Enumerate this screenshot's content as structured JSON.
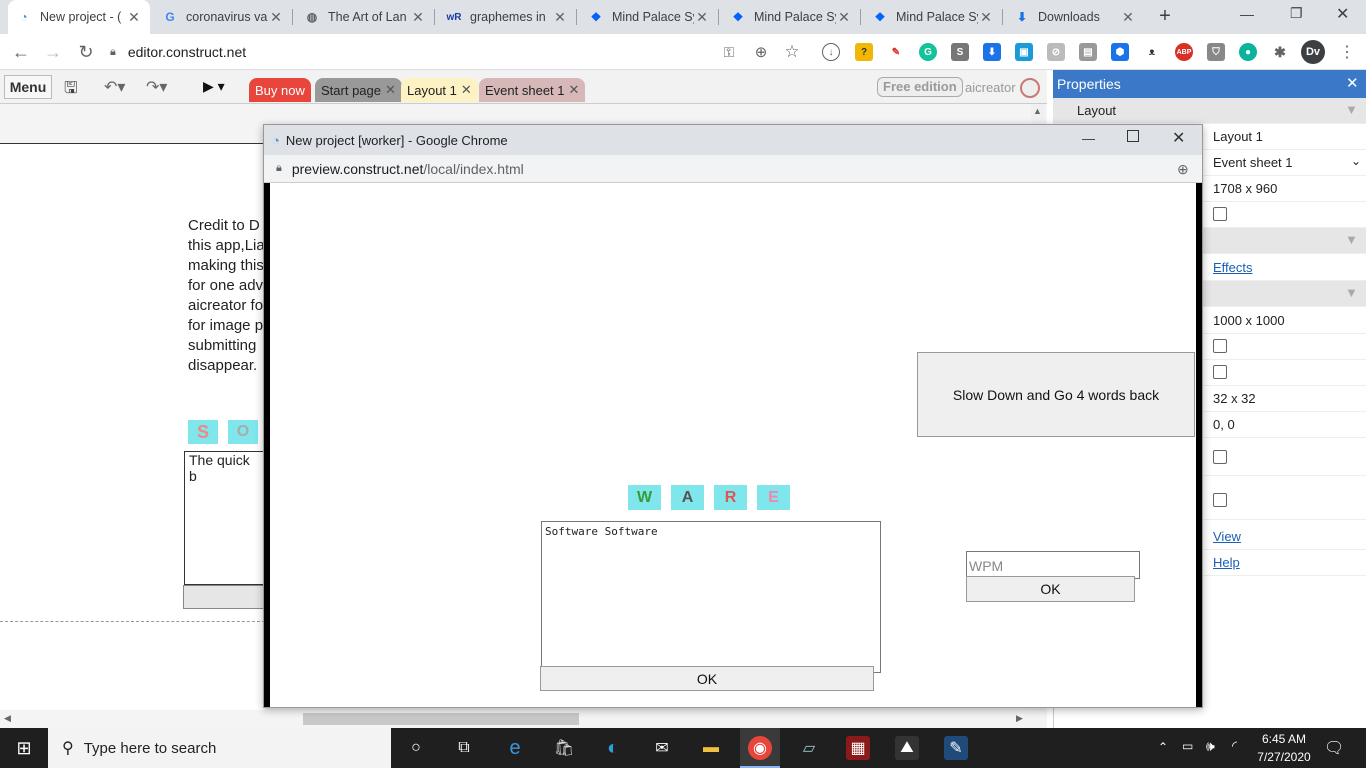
{
  "browser": {
    "tabs": [
      {
        "title": "New project - (",
        "icon": "construct-icon",
        "active": true
      },
      {
        "title": "coronavirus va",
        "icon": "google-icon"
      },
      {
        "title": "The Art of Lan",
        "icon": "globe-icon"
      },
      {
        "title": "graphemes in",
        "icon": "wordreference-icon"
      },
      {
        "title": "Mind Palace Sy",
        "icon": "dropbox-icon"
      },
      {
        "title": "Mind Palace Sy",
        "icon": "dropbox-icon"
      },
      {
        "title": "Mind Palace Sy",
        "icon": "dropbox-icon"
      },
      {
        "title": "Downloads",
        "icon": "download-icon"
      }
    ],
    "url": "editor.construct.net",
    "profile": "Dv"
  },
  "construct": {
    "menu_label": "Menu",
    "tabs": [
      "Buy now",
      "Start page",
      "Layout 1",
      "Event sheet 1"
    ],
    "edition_badge": "Free edition",
    "username": "aicreator",
    "credit_text": "Credit to D this app,Lia making this for one adv aicreator fo for image p submitting disappear.",
    "textbox_text": "The quick b"
  },
  "properties": {
    "title": "Properties",
    "section": "Layout",
    "rows": [
      {
        "value": "Layout 1"
      },
      {
        "value": "Event sheet 1"
      },
      {
        "value": "1708 x 960"
      },
      {
        "value": "Effects"
      },
      {
        "value": "1000 x 1000"
      },
      {
        "value": "32 x 32"
      },
      {
        "value": "0, 0"
      },
      {
        "value": "View"
      },
      {
        "value": "Help"
      }
    ]
  },
  "popup": {
    "title": "New project [worker] - Google Chrome",
    "url_host": "preview.construct.net",
    "url_path": "/local/index.html",
    "slow_button": "Slow Down and Go 4 words back",
    "tiles": [
      "W",
      "A",
      "R",
      "E"
    ],
    "textarea_text": "Software Software",
    "ok_main": "OK",
    "wpm_placeholder": "WPM",
    "ok_wpm": "OK"
  },
  "taskbar": {
    "search_placeholder": "Type here to search",
    "time": "6:45 AM",
    "date": "7/27/2020"
  },
  "colors": {
    "accent_blue": "#3c78c8",
    "buy_now": "#e8453c",
    "tile": "#7fe6ec"
  }
}
